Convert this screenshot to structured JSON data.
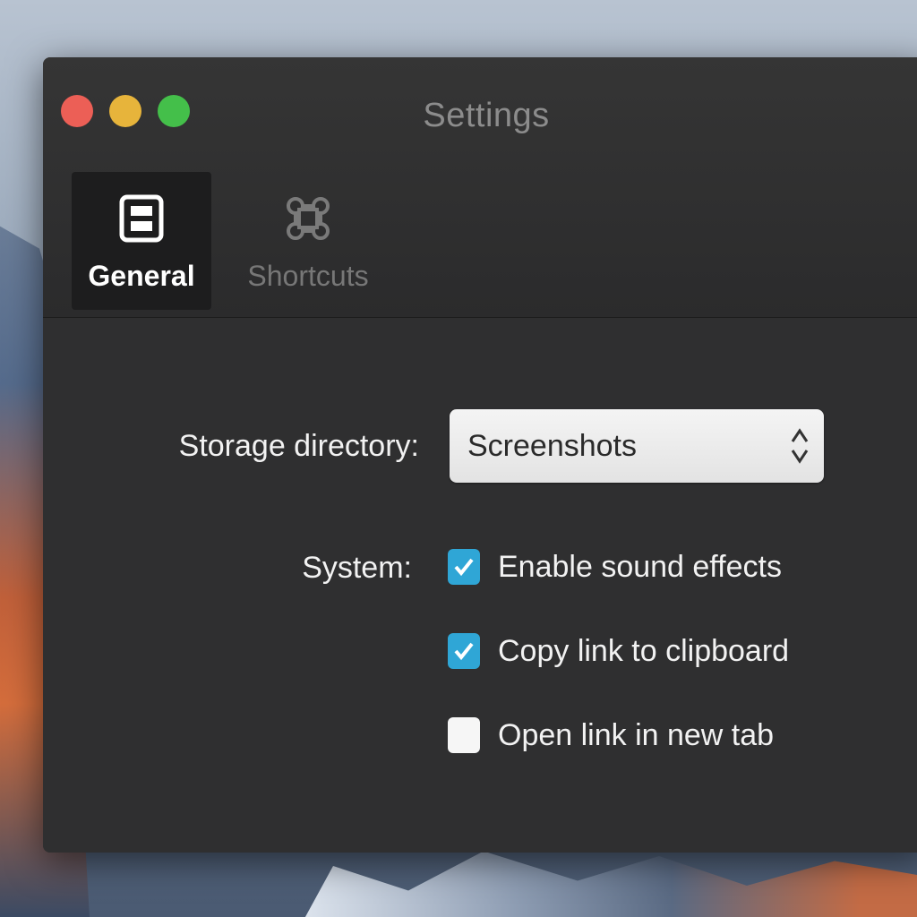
{
  "window": {
    "title": "Settings",
    "controls": [
      "close",
      "minimize",
      "zoom"
    ]
  },
  "tabs": [
    {
      "label": "General",
      "icon": "general-icon",
      "selected": true
    },
    {
      "label": "Shortcuts",
      "icon": "command-icon",
      "selected": false
    }
  ],
  "storage": {
    "label": "Storage directory:",
    "value": "Screenshots"
  },
  "system": {
    "label": "System:",
    "options": [
      {
        "label": "Enable sound effects",
        "checked": true
      },
      {
        "label": "Copy link to clipboard",
        "checked": true
      },
      {
        "label": "Open link in new tab",
        "checked": false
      }
    ]
  },
  "colors": {
    "checkbox_on": "#2fa6d6",
    "close": "#ec5f56",
    "minimize": "#e7b43b",
    "zoom": "#44bf4a"
  }
}
